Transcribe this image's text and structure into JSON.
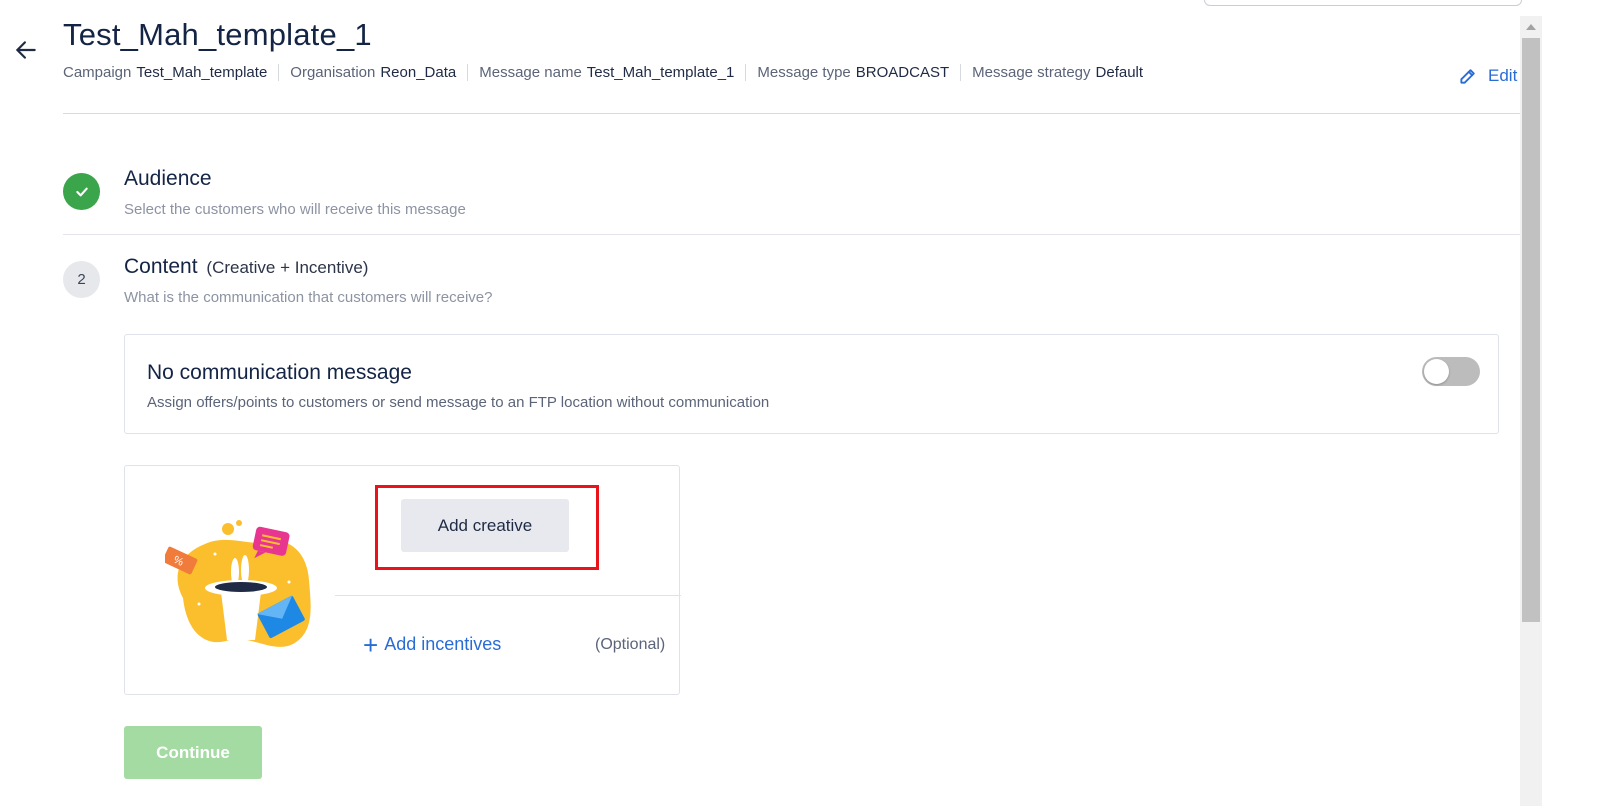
{
  "header": {
    "title": "Test_Mah_template_1",
    "meta": [
      {
        "label": "Campaign",
        "value": "Test_Mah_template"
      },
      {
        "label": "Organisation",
        "value": "Reon_Data"
      },
      {
        "label": "Message name",
        "value": "Test_Mah_template_1"
      },
      {
        "label": "Message type",
        "value": "BROADCAST"
      },
      {
        "label": "Message strategy",
        "value": "Default"
      }
    ],
    "edit_label": "Edit"
  },
  "steps": {
    "audience": {
      "title": "Audience",
      "subtitle": "Select the customers who will receive this message"
    },
    "content": {
      "number": "2",
      "title": "Content",
      "title_note": "(Creative + Incentive)",
      "subtitle": "What is the communication that customers will receive?"
    }
  },
  "no_communication": {
    "title": "No communication message",
    "subtitle": "Assign offers/points to customers or send message to an FTP location without communication",
    "toggle_on": false
  },
  "creative": {
    "add_creative_label": "Add creative",
    "add_incentives_label": "Add incentives",
    "optional_label": "(Optional)"
  },
  "continue_label": "Continue",
  "colors": {
    "accent": "#2a6cd6",
    "success": "#3aa54b",
    "highlight": "#e8131b",
    "continue_disabled": "#a4dba2"
  }
}
